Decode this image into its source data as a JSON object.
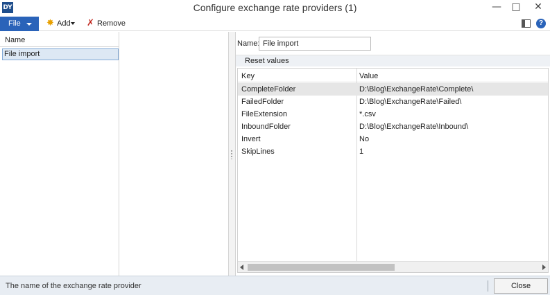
{
  "window": {
    "title": "Configure exchange rate providers (1)",
    "app_icon_glyph": "DY",
    "minimize_glyph": "—",
    "maximize_glyph": "□",
    "close_glyph": "✕"
  },
  "toolbar": {
    "file_label": "File",
    "add_label": "Add",
    "remove_label": "Remove",
    "add_icon_glyph": "✸",
    "remove_icon_glyph": "✗",
    "help_glyph": "?",
    "icons": [
      "add-icon",
      "remove-icon",
      "layout-icon",
      "help-icon"
    ]
  },
  "list": {
    "column_header": "Name",
    "items": [
      {
        "label": "File import",
        "selected": true
      }
    ]
  },
  "details": {
    "name_label": "Name:",
    "name_value": "File import",
    "reset_label": "Reset values",
    "grid": {
      "key_header": "Key",
      "value_header": "Value",
      "rows": [
        {
          "key": "CompleteFolder",
          "value": "D:\\Blog\\ExchangeRate\\Complete\\"
        },
        {
          "key": "FailedFolder",
          "value": "D:\\Blog\\ExchangeRate\\Failed\\"
        },
        {
          "key": "FileExtension",
          "value": "*.csv"
        },
        {
          "key": "InboundFolder",
          "value": "D:\\Blog\\ExchangeRate\\Inbound\\"
        },
        {
          "key": "Invert",
          "value": "No"
        },
        {
          "key": "SkipLines",
          "value": "1"
        }
      ],
      "selected_row": 0
    }
  },
  "status": {
    "text": "The name of the exchange rate provider",
    "close_label": "Close"
  },
  "colors": {
    "accent": "#2a63b9",
    "selection": "#dde8f4",
    "status_bar": "#e8edf3"
  }
}
